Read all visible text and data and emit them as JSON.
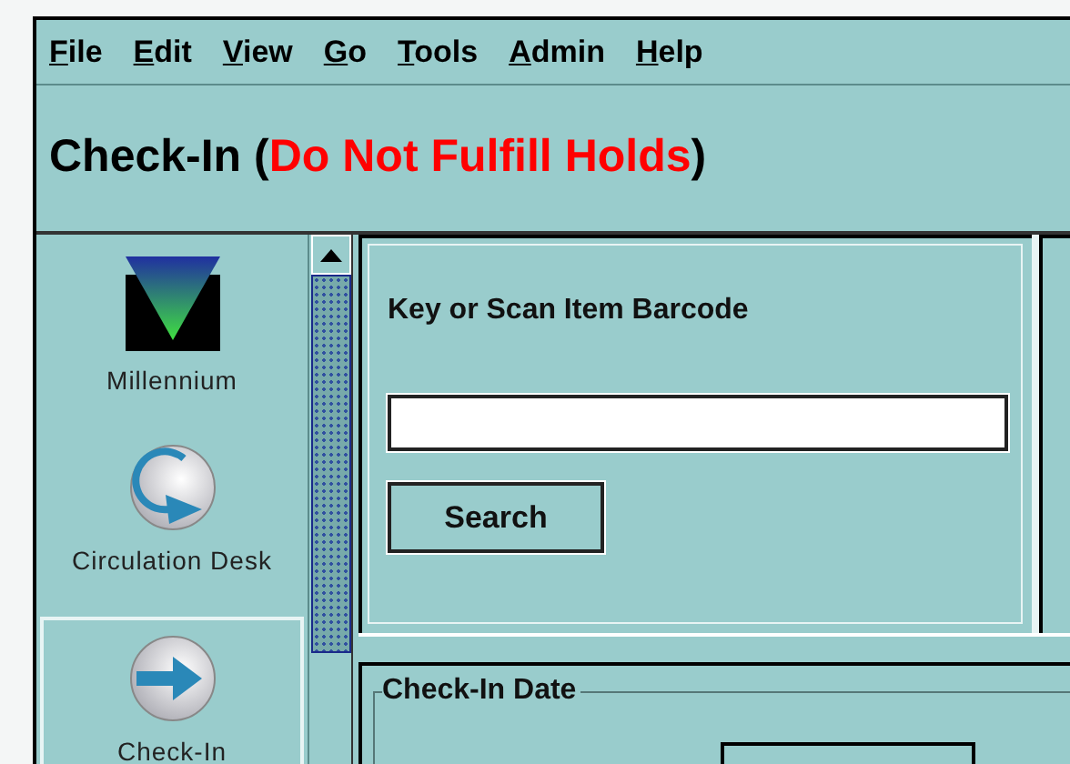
{
  "menu": [
    {
      "label": "File"
    },
    {
      "label": "Edit"
    },
    {
      "label": "View"
    },
    {
      "label": "Go"
    },
    {
      "label": "Tools"
    },
    {
      "label": "Admin"
    },
    {
      "label": "Help"
    }
  ],
  "title_parts": [
    {
      "text": "Check-In (",
      "kind": "normal"
    },
    {
      "text": "Do Not Fulfill Holds",
      "kind": "warning"
    },
    {
      "text": ")",
      "kind": "normal"
    }
  ],
  "sidebar": {
    "items": [
      {
        "label": "Millennium",
        "kind": "logo",
        "selected": false
      },
      {
        "label": "Circulation Desk",
        "kind": "circulation",
        "selected": false
      },
      {
        "label": "Check-In",
        "kind": "checkin",
        "selected": true
      }
    ]
  },
  "barcode_panel": {
    "label": "Key or Scan Item Barcode",
    "button": "Search"
  },
  "date_panel": {
    "legend": "Check-In Date"
  }
}
